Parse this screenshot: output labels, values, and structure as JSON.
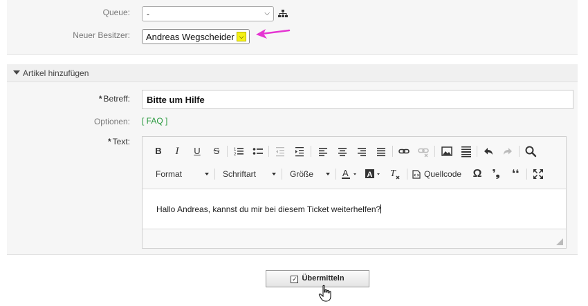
{
  "top_panel": {
    "queue_label": "Queue:",
    "queue_value": "-",
    "owner_label": "Neuer Besitzer:",
    "owner_value": "Andreas Wegscheider"
  },
  "annotation": {
    "arrow_color": "#e535d2"
  },
  "article_section": {
    "title": "Artikel hinzufügen",
    "subject_label": "Betreff:",
    "subject_value": "Bitte um Hilfe",
    "options_label": "Optionen:",
    "faq_link": "[ FAQ ]",
    "text_label": "Text:",
    "required_marker": "*"
  },
  "editor": {
    "toolbar_row1": [
      "bold-icon",
      "italic-icon",
      "underline-icon",
      "strikethrough-icon",
      "numbered-list-icon",
      "bulleted-list-icon",
      "outdent-icon",
      "indent-icon",
      "align-left-icon",
      "align-center-icon",
      "align-right-icon",
      "justify-icon",
      "link-icon",
      "unlink-icon",
      "image-icon",
      "horizontal-line-icon",
      "undo-icon",
      "redo-icon",
      "find-icon"
    ],
    "format_label": "Format",
    "font_label": "Schriftart",
    "size_label": "Größe",
    "source_label": "Quellcode",
    "toolbar_row2_icons": [
      "text-color-icon",
      "background-color-icon",
      "remove-format-icon",
      "source-code-icon",
      "special-char-icon",
      "quote-open-icon",
      "quote-close-icon",
      "maximize-icon"
    ],
    "body_text": "Hallo Andreas, kannst du mir bei diesem Ticket weiterhelfen?"
  },
  "submit": {
    "label": "Übermitteln"
  }
}
